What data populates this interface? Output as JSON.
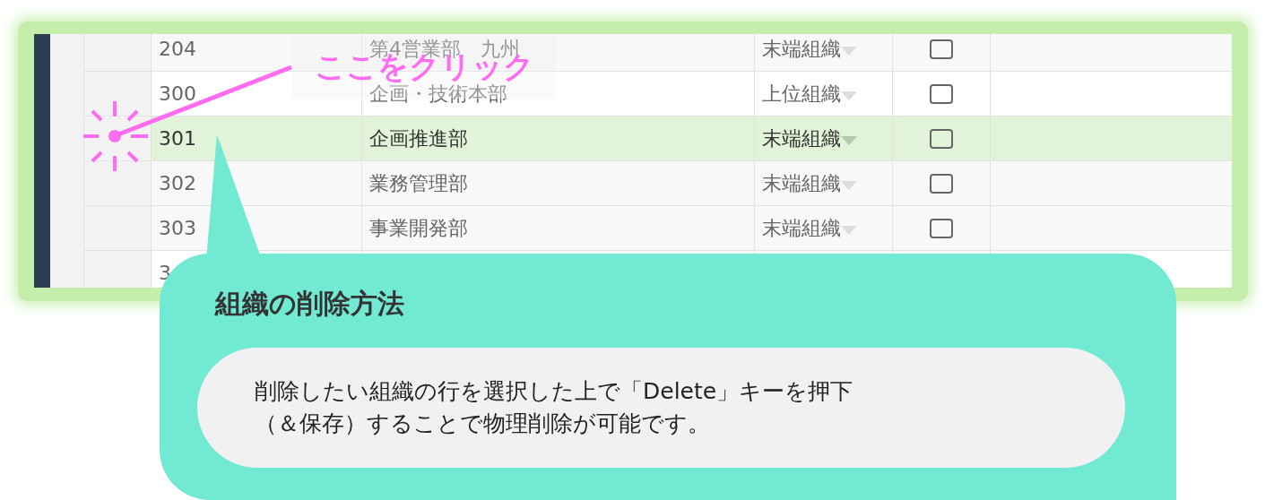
{
  "table": {
    "rows": [
      {
        "code": "204",
        "name": "第4営業部　九州",
        "type": "末端組織",
        "checked": false,
        "selected": false
      },
      {
        "code": "300",
        "name": "企画・技術本部",
        "type": "上位組織",
        "checked": false,
        "selected": false
      },
      {
        "code": "301",
        "name": "企画推進部",
        "type": "末端組織",
        "checked": false,
        "selected": true
      },
      {
        "code": "302",
        "name": "業務管理部",
        "type": "末端組織",
        "checked": false,
        "selected": false
      },
      {
        "code": "303",
        "name": "事業開発部",
        "type": "末端組織",
        "checked": false,
        "selected": false
      },
      {
        "code": "3",
        "selected": false
      }
    ]
  },
  "click_hint": {
    "label": "ここをクリック"
  },
  "callout": {
    "title": "組織の削除方法",
    "body_lines": [
      "削除したい組織の行を選択した上で「Delete」キーを押下",
      "（＆保存）することで物理削除が可能です。"
    ]
  }
}
